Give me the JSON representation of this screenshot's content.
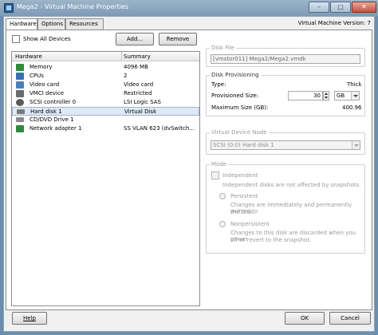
{
  "window": {
    "title": "Mega2 - Virtual Machine Properties",
    "min_glyph": "–",
    "max_glyph": "□",
    "close_glyph": "✕"
  },
  "tabs": [
    {
      "label": "Hardware",
      "active": true
    },
    {
      "label": "Options",
      "active": false
    },
    {
      "label": "Resources",
      "active": false
    }
  ],
  "vm_version": "Virtual Machine Version: 7",
  "hardware_panel": {
    "show_all_label": "Show All Devices",
    "add_label": "Add...",
    "remove_label": "Remove",
    "columns": [
      "Hardware",
      "Summary"
    ],
    "rows": [
      {
        "name": "Memory",
        "summary": "4096 MB",
        "icon": "memory-icon",
        "color": "#2f8a3a"
      },
      {
        "name": "CPUs",
        "summary": "2",
        "icon": "cpu-icon",
        "color": "#3a6fb0"
      },
      {
        "name": "Video card",
        "summary": "Video card",
        "icon": "video-card-icon",
        "color": "#4a7fbf"
      },
      {
        "name": "VMCI device",
        "summary": "Restricted",
        "icon": "vmci-icon",
        "color": "#6a6a6a"
      },
      {
        "name": "SCSI controller 0",
        "summary": "LSI Logic SAS",
        "icon": "scsi-icon",
        "color": "#5a5a5a"
      },
      {
        "name": "Hard disk 1",
        "summary": "Virtual Disk",
        "icon": "hard-disk-icon",
        "color": "#7a7a7a",
        "selected": true
      },
      {
        "name": "CD/DVD Drive 1",
        "summary": "",
        "icon": "cd-dvd-icon",
        "color": "#8a8a8a"
      },
      {
        "name": "Network adapter 1",
        "summary": "SS VLAN 623 (dvSwitch...",
        "icon": "network-icon",
        "color": "#2f8a3a"
      }
    ]
  },
  "disk_file": {
    "label": "Disk File",
    "value": "[vmstor011] Mega2/Mega2.vmdk"
  },
  "disk_provisioning": {
    "label": "Disk Provisioning",
    "type_label": "Type:",
    "type_value": "Thick",
    "provisioned_label": "Provisioned Size:",
    "provisioned_value": "30",
    "unit": "GB",
    "max_label": "Maximum Size (GB):",
    "max_value": "400.96"
  },
  "virtual_device_node": {
    "label": "Virtual Device Node",
    "value": "SCSI (0:0) Hard disk 1"
  },
  "mode": {
    "label": "Mode",
    "independent_label": "Independent",
    "independent_desc": "Independent disks are not affected by snapshots.",
    "persistent_label": "Persistent",
    "persistent_desc_1": "Changes are immediately and permanently written to",
    "persistent_desc_2": "the disk.",
    "nonpersistent_label": "Nonpersistent",
    "nonpersistent_desc_1": "Changes to this disk are discarded when you power",
    "nonpersistent_desc_2": "off or revert to the snapshot."
  },
  "footer": {
    "help_label": "Help",
    "ok_label": "OK",
    "cancel_label": "Cancel"
  }
}
